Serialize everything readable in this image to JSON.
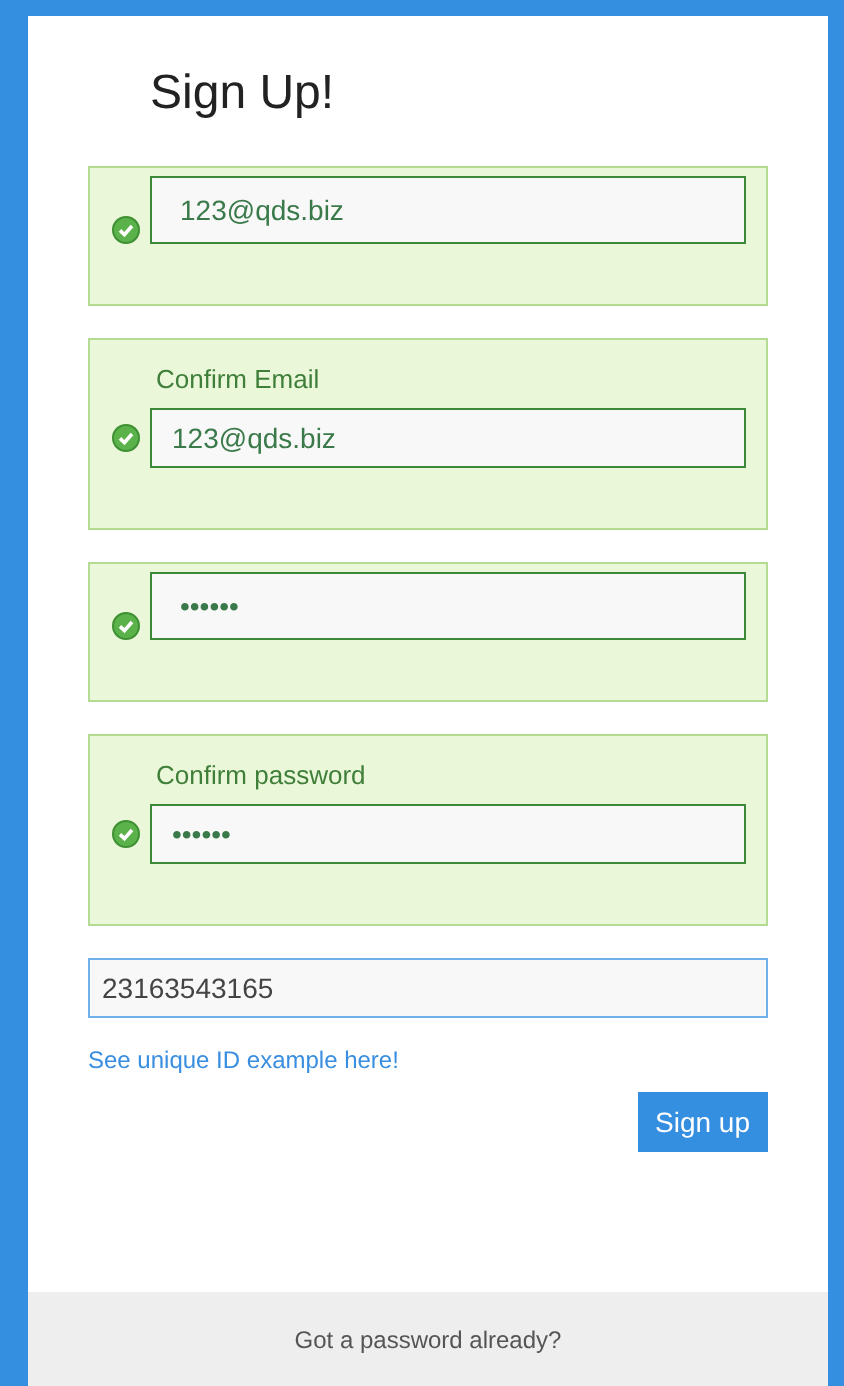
{
  "title": "Sign Up!",
  "groups": [
    {
      "value": "123@qds.biz",
      "valid": true
    },
    {
      "label": "Confirm Email",
      "value": "123@qds.biz",
      "valid": true
    },
    {
      "value": "••••••",
      "valid": true
    },
    {
      "label": "Confirm password",
      "value": "••••••",
      "valid": true
    }
  ],
  "unique_id": {
    "value": "23163543165"
  },
  "link": "See unique ID example here!",
  "submit": "Sign up",
  "footer": "Got a password already?"
}
